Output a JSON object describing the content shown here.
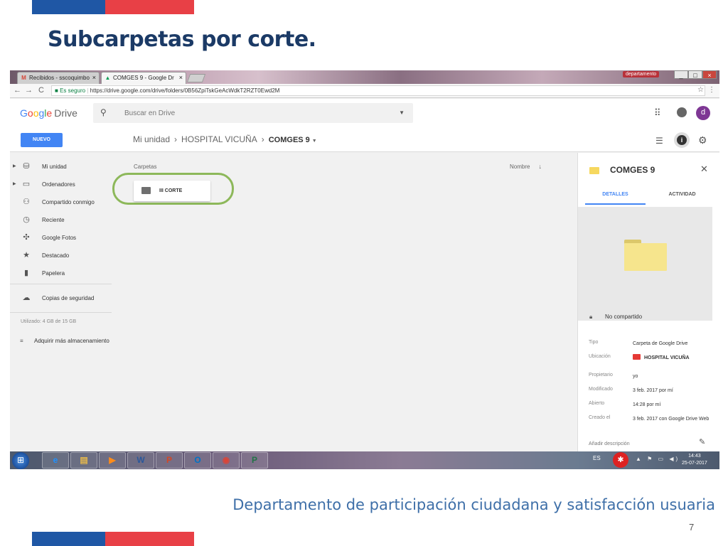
{
  "slide": {
    "title": "Subcarpetas por corte.",
    "footer": "Departamento de participación ciudadana y satisfacción usuaria",
    "page_number": "7"
  },
  "browser": {
    "tabs": [
      {
        "label": "Recibidos - sscoquimbo",
        "icon": "gmail-icon",
        "close": "×"
      },
      {
        "label": "COMGES 9 - Google Dr",
        "icon": "drive-icon",
        "close": "×"
      }
    ],
    "user_badge": "departamento",
    "window_buttons": [
      "_",
      "□",
      "×"
    ],
    "nav_icons": [
      "←",
      "→",
      "C",
      "⌂"
    ],
    "secure_label": "Es seguro",
    "url": "https://drive.google.com/drive/folders/0B56ZpiTskGeAcWdkT2RZT0Ewd2M"
  },
  "drive": {
    "logo_google": [
      "G",
      "o",
      "o",
      "g",
      "l",
      "e"
    ],
    "logo_drive": "Drive",
    "search_placeholder": "Buscar en Drive",
    "avatar_letter": "d",
    "new_button": "NUEVO",
    "breadcrumb": [
      "Mi unidad",
      "HOSPITAL VICUÑA",
      "COMGES 9"
    ],
    "sidebar": [
      {
        "label": "Mi unidad",
        "icon": "drive-icon",
        "expandable": true
      },
      {
        "label": "Ordenadores",
        "icon": "computer-icon",
        "expandable": true
      },
      {
        "label": "Compartido conmigo",
        "icon": "people-icon",
        "expandable": false
      },
      {
        "label": "Reciente",
        "icon": "clock-icon",
        "expandable": false
      },
      {
        "label": "Google Fotos",
        "icon": "photos-icon",
        "expandable": false
      },
      {
        "label": "Destacado",
        "icon": "star-icon",
        "expandable": false
      },
      {
        "label": "Papelera",
        "icon": "trash-icon",
        "expandable": false
      },
      {
        "label": "Copias de seguridad",
        "icon": "cloud-icon",
        "expandable": false
      }
    ],
    "quota": "Utilizado: 4 GB de 15 GB",
    "buy_storage": "Adquirir más almacenamiento",
    "folders_label": "Carpetas",
    "sort_label": "Nombre",
    "folders": [
      {
        "name": "III CORTE"
      }
    ]
  },
  "details": {
    "title": "COMGES 9",
    "tab_details": "DETALLES",
    "tab_activity": "ACTIVIDAD",
    "sharing": "No compartido",
    "rows": [
      {
        "key": "Tipo",
        "value": "Carpeta de Google Drive"
      },
      {
        "key": "Ubicación",
        "value": "HOSPITAL VICUÑA"
      },
      {
        "key": "Propietario",
        "value": "yo"
      },
      {
        "key": "Modificado",
        "value": "3 feb. 2017 por mí"
      },
      {
        "key": "Abierto",
        "value": "14:28 por mí"
      },
      {
        "key": "Creado el",
        "value": "3 feb. 2017 con Google Drive Web"
      }
    ],
    "add_description": "Añadir descripción"
  },
  "taskbar": {
    "apps": [
      {
        "name": "internet-explorer-icon",
        "glyph": "e",
        "color": "#1e90ff"
      },
      {
        "name": "file-explorer-icon",
        "glyph": "▤",
        "color": "#e6b84c"
      },
      {
        "name": "media-player-icon",
        "glyph": "▶",
        "color": "#ff8c1a"
      },
      {
        "name": "word-icon",
        "glyph": "W",
        "color": "#2b579a"
      },
      {
        "name": "powerpoint-icon",
        "glyph": "P",
        "color": "#d24726"
      },
      {
        "name": "outlook-icon",
        "glyph": "O",
        "color": "#0072c6"
      },
      {
        "name": "chrome-icon",
        "glyph": "◉",
        "color": "#db4437"
      },
      {
        "name": "publisher-icon",
        "glyph": "P",
        "color": "#217346"
      }
    ],
    "language": "ES",
    "time": "14:43",
    "date": "25-07-2017"
  }
}
